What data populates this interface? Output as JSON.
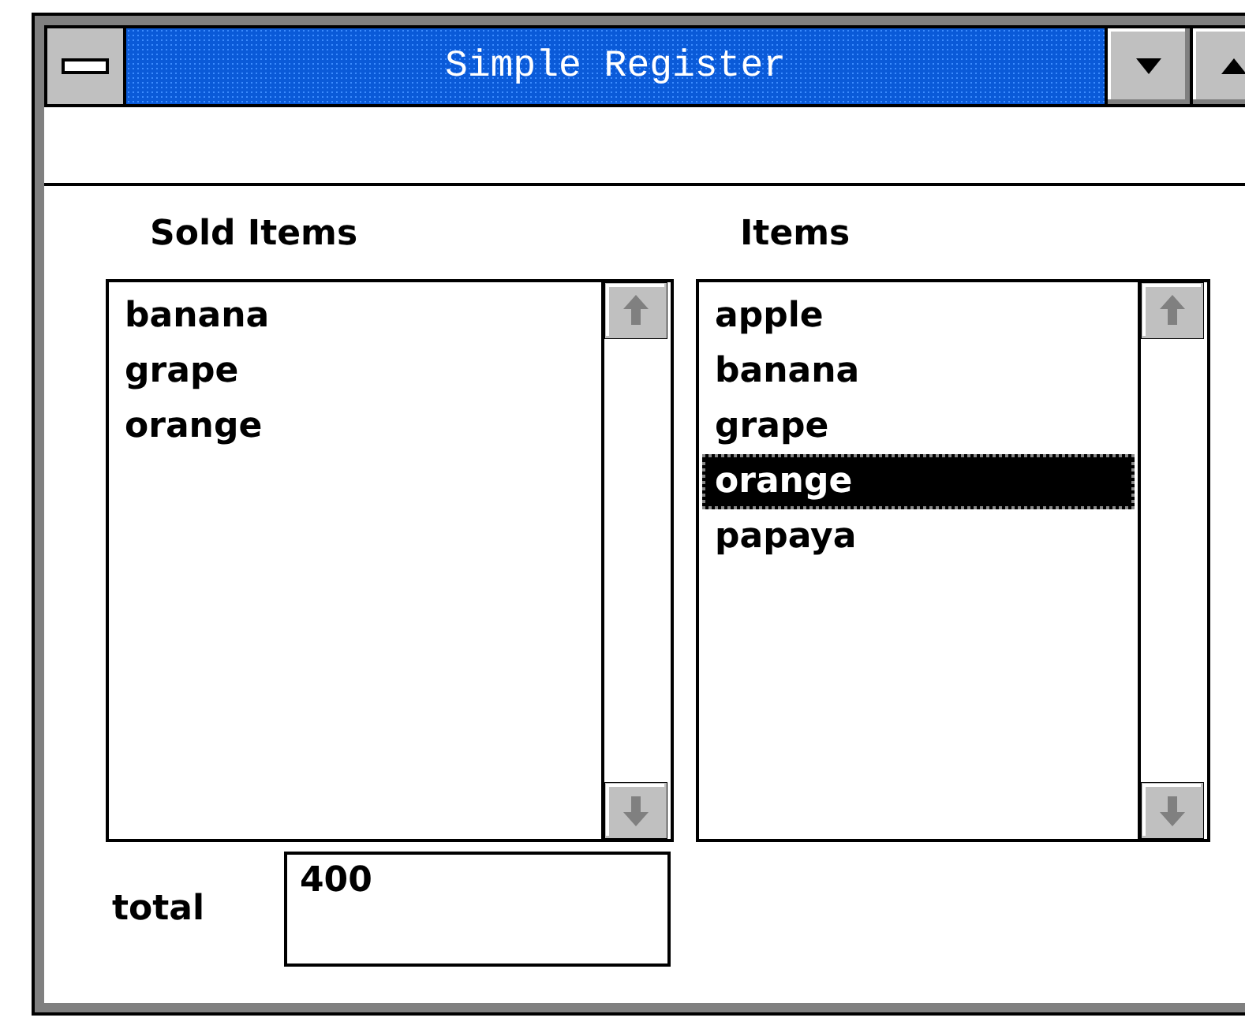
{
  "window": {
    "title": "Simple Register"
  },
  "lists": [
    {
      "label": "Sold Items",
      "items": [
        {
          "text": "banana",
          "selected": false
        },
        {
          "text": "grape",
          "selected": false
        },
        {
          "text": "orange",
          "selected": false
        }
      ]
    },
    {
      "label": "Items",
      "items": [
        {
          "text": "apple",
          "selected": false
        },
        {
          "text": "banana",
          "selected": false
        },
        {
          "text": "grape",
          "selected": false
        },
        {
          "text": "orange",
          "selected": true
        },
        {
          "text": "papaya",
          "selected": false
        }
      ]
    }
  ],
  "total": {
    "label": "total",
    "value": "400"
  }
}
